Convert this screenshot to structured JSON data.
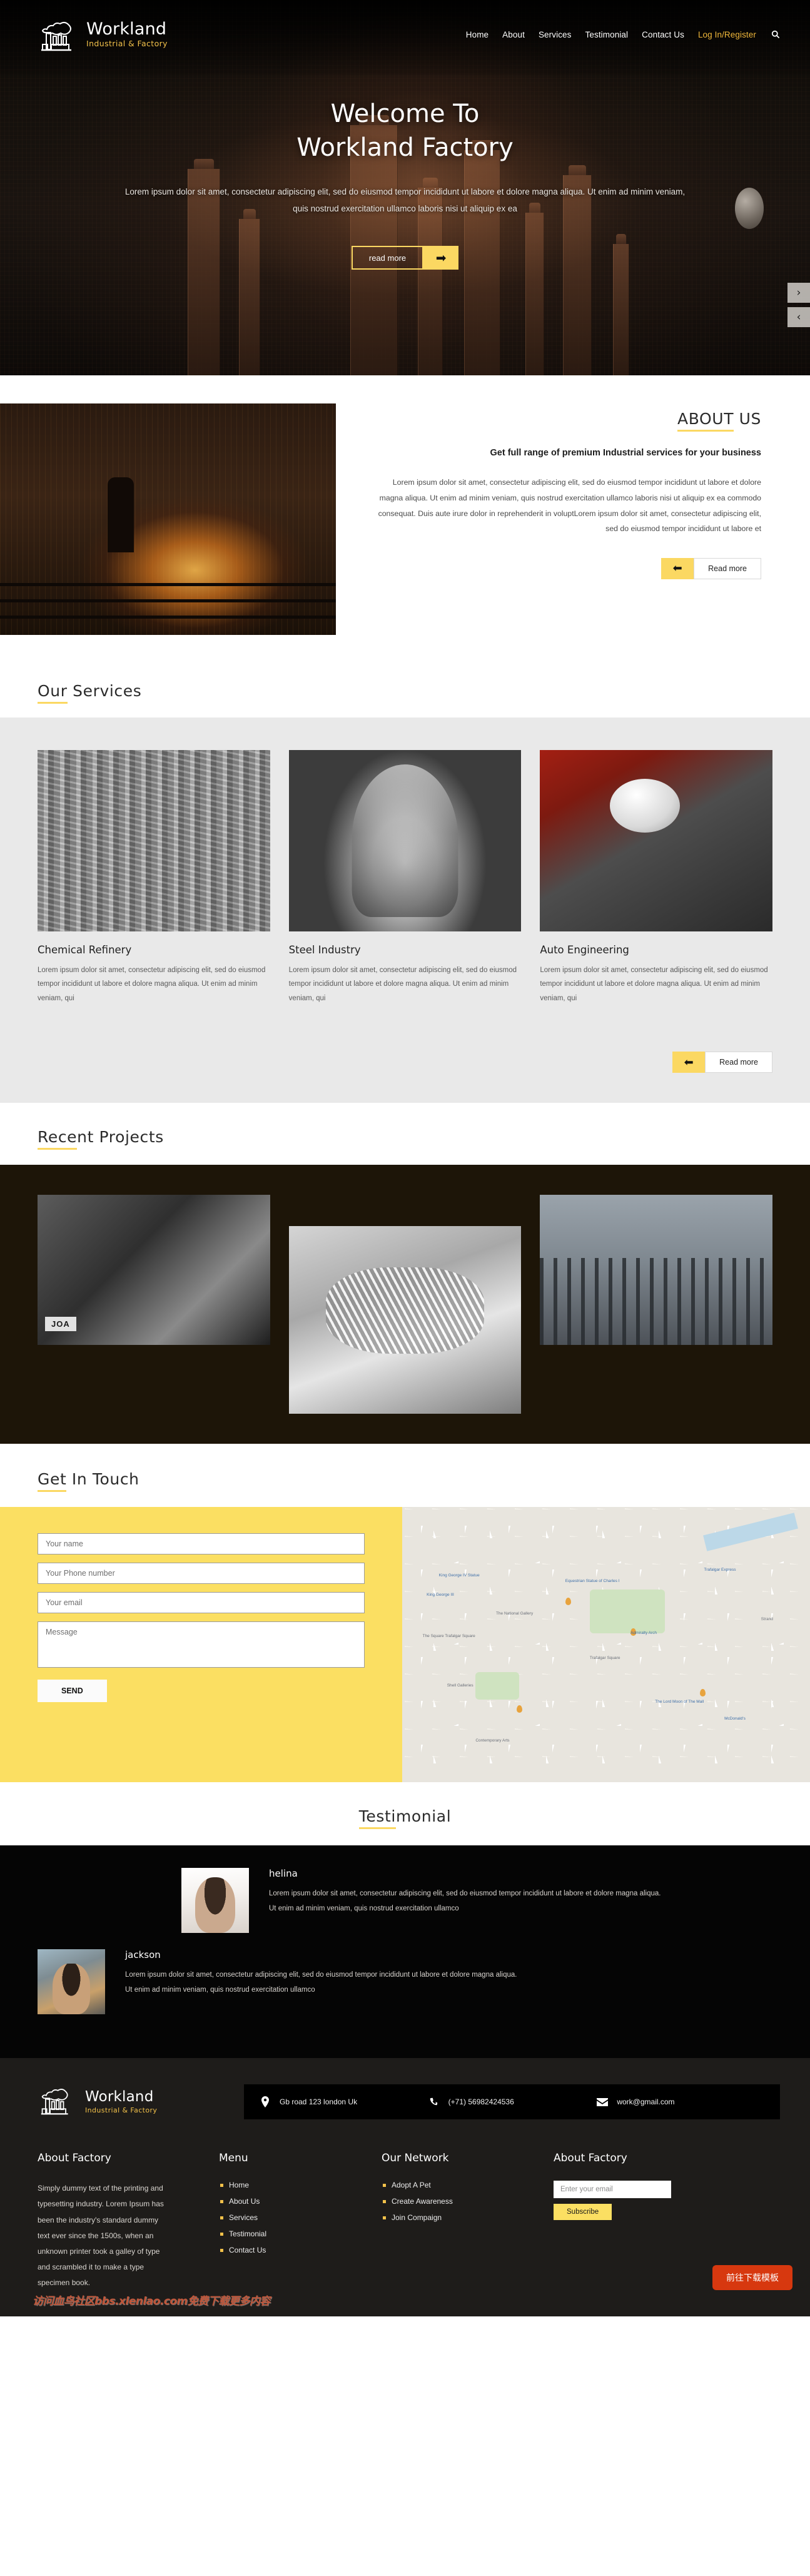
{
  "brand": {
    "name": "Workland",
    "tagline": "Industrial & Factory",
    "logo_icon": "factory-icon"
  },
  "nav": {
    "items": [
      {
        "label": "Home",
        "accent": false
      },
      {
        "label": "About",
        "accent": false
      },
      {
        "label": "Services",
        "accent": false
      },
      {
        "label": "Testimonial",
        "accent": false
      },
      {
        "label": "Contact Us",
        "accent": false
      },
      {
        "label": "Log In/Register",
        "accent": true
      }
    ],
    "search_icon": "search-icon"
  },
  "hero": {
    "title_line1": "Welcome To",
    "title_line2": "Workland Factory",
    "paragraph": "Lorem ipsum dolor sit amet, consectetur adipiscing elit, sed do eiusmod tempor incididunt ut labore et dolore magna aliqua. Ut enim ad minim veniam, quis nostrud exercitation ullamco laboris nisi ut aliquip ex ea",
    "cta_label": "read more",
    "cta_arrow": "➡",
    "slider_next": "›",
    "slider_prev": "‹"
  },
  "about": {
    "heading_underlined": "ABOUT",
    "heading_rest": " US",
    "lead": "Get full range of premium Industrial services for your business",
    "body": "Lorem ipsum dolor sit amet, consectetur adipiscing elit, sed do eiusmod tempor incididunt ut labore et dolore magna aliqua. Ut enim ad minim veniam, quis nostrud exercitation ullamco laboris nisi ut aliquip ex ea commodo consequat. Duis aute irure dolor in reprehenderit in voluptLorem ipsum dolor sit amet, consectetur adipiscing elit, sed do eiusmod tempor incididunt ut labore et",
    "cta_label": "Read more",
    "cta_arrow": "⬅"
  },
  "services": {
    "heading_underlined": "Our",
    "heading_rest": " Services",
    "cards": [
      {
        "title": "Chemical Refinery",
        "text": "Lorem ipsum dolor sit amet, consectetur adipiscing elit, sed do eiusmod tempor incididunt ut labore et dolore magna aliqua. Ut enim ad minim veniam, qui"
      },
      {
        "title": "Steel Industry",
        "text": "Lorem ipsum dolor sit amet, consectetur adipiscing elit, sed do eiusmod tempor incididunt ut labore et dolore magna aliqua. Ut enim ad minim veniam, qui"
      },
      {
        "title": "Auto Engineering",
        "text": "Lorem ipsum dolor sit amet, consectetur adipiscing elit, sed do eiusmod tempor incididunt ut labore et dolore magna aliqua. Ut enim ad minim veniam, qui"
      }
    ],
    "cta_label": "Read more",
    "cta_arrow": "⬅"
  },
  "projects": {
    "heading_underlined": "Rece",
    "heading_rest": "nt Projects",
    "items": [
      {
        "caption": "JOA"
      },
      {
        "caption": ""
      },
      {
        "caption": ""
      }
    ]
  },
  "contact": {
    "heading_underlined": "Get",
    "heading_rest": " In Touch",
    "fields": {
      "name_placeholder": "Your name",
      "phone_placeholder": "Your Phone number",
      "email_placeholder": "Your email",
      "message_placeholder": "Message"
    },
    "send_label": "SEND",
    "map_labels": [
      "King George IV Statue",
      "King George III",
      "The Square Trafalgar Square",
      "Equestrian Statue of Charles I",
      "Trafalgar Square",
      "Trafalgar Express",
      "The National Gallery",
      "Admiralty Arch",
      "Shell Galleries",
      "The Lord Moon of The Mall",
      "McDonald's",
      "Contemporary Arts",
      "Strand"
    ]
  },
  "testimonial": {
    "heading_underlined": "Testi",
    "heading_rest": "monial",
    "items": [
      {
        "name": "helina",
        "text": "Lorem ipsum dolor sit amet, consectetur adipiscing elit, sed do eiusmod tempor incididunt ut labore et dolore magna aliqua. Ut enim ad minim veniam, quis nostrud exercitation ullamco"
      },
      {
        "name": "jackson",
        "text": "Lorem ipsum dolor sit amet, consectetur adipiscing elit, sed do eiusmod tempor incididunt ut labore et dolore magna aliqua. Ut enim ad minim veniam, quis nostrud exercitation ullamco"
      }
    ]
  },
  "footer": {
    "contact_strip": [
      {
        "icon": "location-pin-icon",
        "value": "Gb road 123 london Uk"
      },
      {
        "icon": "phone-icon",
        "value": "(+71) 56982424536"
      },
      {
        "icon": "envelope-icon",
        "value": "work@gmail.com"
      }
    ],
    "about": {
      "title": "About Factory",
      "text": "Simply dummy text of the printing and typesetting industry. Lorem Ipsum has been the industry's standard dummy text ever since the 1500s, when an unknown printer took a galley of type and scrambled it to make a type specimen book."
    },
    "menu": {
      "title": "Menu",
      "items": [
        "Home",
        "About Us",
        "Services",
        "Testimonial",
        "Contact Us"
      ]
    },
    "network": {
      "title": "Our Network",
      "items": [
        "Adopt A Pet",
        "Create Awareness",
        "Join Compaign"
      ]
    },
    "newsletter": {
      "title": "About Factory",
      "placeholder": "Enter your email",
      "button": "Subscribe"
    }
  },
  "overlay": {
    "watermark": "访问血鸟社区bbs.xlenlao.com免费下载更多内容",
    "download_badge": "前往下载模板"
  },
  "colors": {
    "accent_yellow": "#fbd862",
    "accent_gold": "#f0b73a",
    "dark": "#1e1c1a",
    "badge_red": "#d7380f"
  }
}
